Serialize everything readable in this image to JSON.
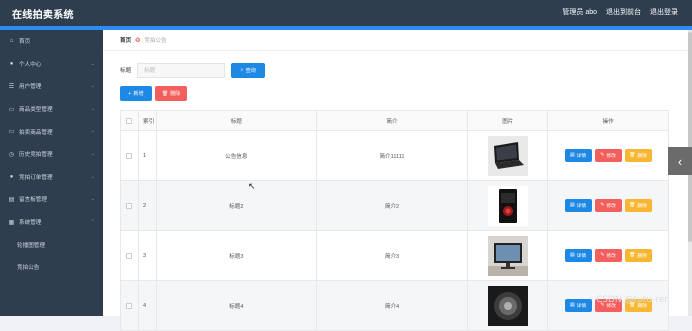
{
  "app": {
    "title": "在线拍卖系统"
  },
  "header": {
    "user_label": "管理员 abo",
    "back_label": "退出到前台",
    "logout_label": "退出登录"
  },
  "sidebar": {
    "items": [
      {
        "label": "首页",
        "icon": "home-icon"
      },
      {
        "label": "个人中心",
        "icon": "user-icon"
      },
      {
        "label": "用户管理",
        "icon": "list-icon"
      },
      {
        "label": "商品类型管理",
        "icon": "folder-icon"
      },
      {
        "label": "拍卖商品管理",
        "icon": "folder-icon"
      },
      {
        "label": "历史竞拍管理",
        "icon": "history-icon"
      },
      {
        "label": "竞拍订单管理",
        "icon": "user-icon"
      },
      {
        "label": "留言板管理",
        "icon": "message-icon"
      },
      {
        "label": "系统管理",
        "icon": "grid-icon"
      }
    ],
    "sub_items": [
      {
        "label": "轮播图管理"
      },
      {
        "label": "竞拍公告"
      }
    ]
  },
  "breadcrumb": {
    "home": "首页",
    "current": "竞拍公告"
  },
  "search": {
    "label": "标题",
    "placeholder": "标题",
    "button": "查询"
  },
  "toolbar": {
    "add": "新增",
    "delete": "删除"
  },
  "table": {
    "headers": [
      "索引",
      "标题",
      "简介",
      "图片",
      "操作"
    ],
    "rows": [
      {
        "index": "1",
        "title": "公告信息",
        "brief": "简介11111"
      },
      {
        "index": "2",
        "title": "标题2",
        "brief": "简介2"
      },
      {
        "index": "3",
        "title": "标题3",
        "brief": "简介3"
      },
      {
        "index": "4",
        "title": "标题4",
        "brief": "简介4"
      }
    ],
    "ops": {
      "detail": "详情",
      "edit": "修改",
      "delete": "删除"
    }
  },
  "watermark": "CSDN @tutu-rer",
  "colors": {
    "topbar": "#2f3e4f",
    "accent": "#2d8cf0",
    "primary_btn": "#1e88e5",
    "danger_btn": "#f25f5c",
    "warn_btn": "#f7b733"
  }
}
